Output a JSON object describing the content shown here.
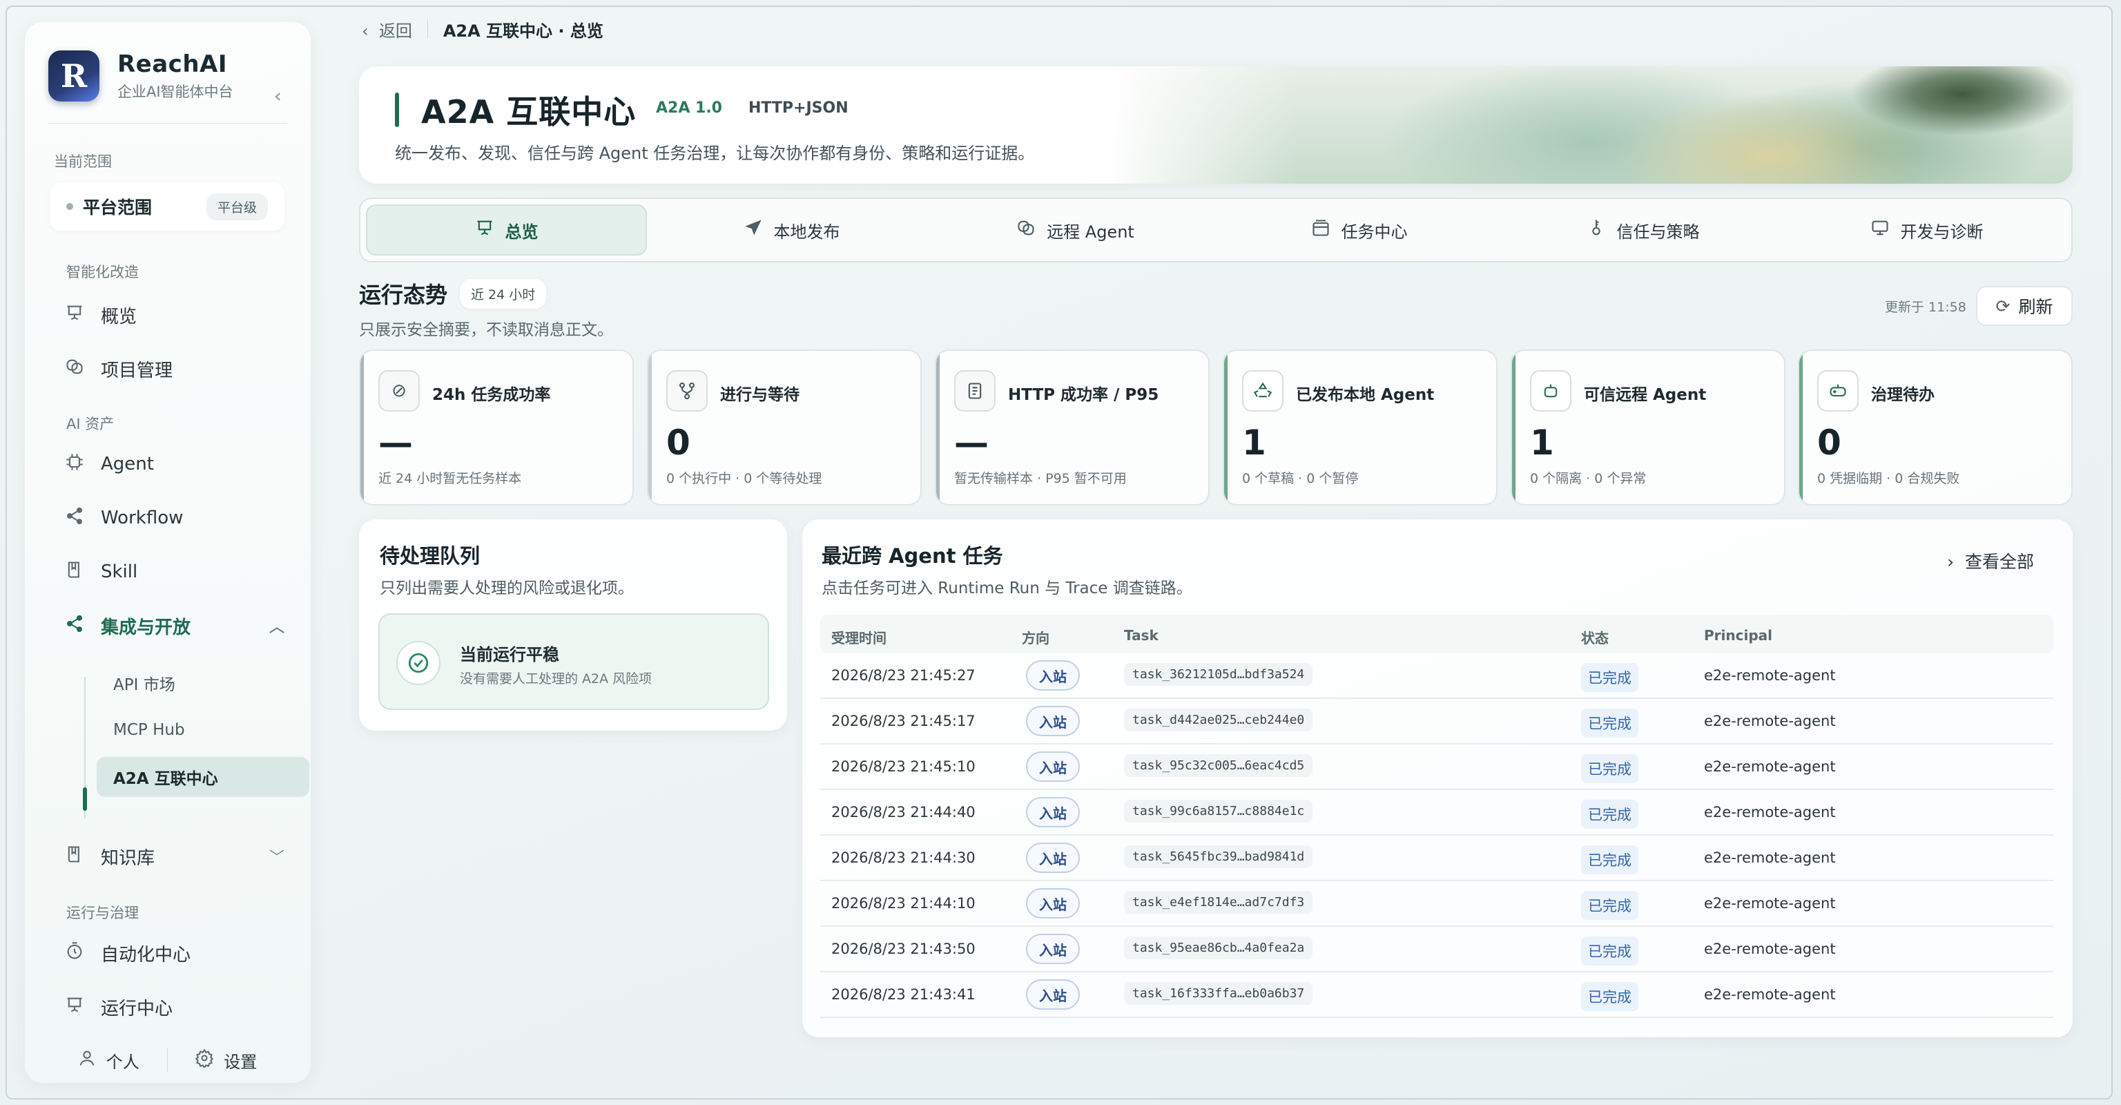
{
  "sidebar": {
    "brand": {
      "name": "ReachAI",
      "subtitle": "企业AI智能体中台",
      "logo_letter": "R"
    },
    "scope_label": "当前范围",
    "scope": {
      "name": "平台范围",
      "badge": "平台级"
    },
    "groups": {
      "g1": "智能化改造",
      "g2": "AI 资产",
      "g3": "运行与治理"
    },
    "items": {
      "overview": "概览",
      "projects": "项目管理",
      "agent": "Agent",
      "workflow": "Workflow",
      "skill": "Skill",
      "integration": "集成与开放",
      "knowledge": "知识库",
      "automation": "自动化中心",
      "runtime": "运行中心"
    },
    "sub_items": {
      "api_market": "API 市场",
      "mcp_hub": "MCP Hub",
      "a2a": "A2A 互联中心"
    },
    "bottom": {
      "personal": "个人",
      "settings": "设置"
    }
  },
  "breadcrumb": {
    "back": "返回",
    "title": "A2A 互联中心 · 总览"
  },
  "hero": {
    "title": "A2A 互联中心",
    "tag_version": "A2A 1.0",
    "tag_protocol": "HTTP+JSON",
    "subtitle": "统一发布、发现、信任与跨 Agent 任务治理，让每次协作都有身份、策略和运行证据。"
  },
  "tabs": {
    "overview": "总览",
    "local_publish": "本地发布",
    "remote_agent": "远程 Agent",
    "task_center": "任务中心",
    "trust_policy": "信任与策略",
    "dev_diag": "开发与诊断"
  },
  "status_section": {
    "title": "运行态势",
    "chip": "近 24 小时",
    "desc": "只展示安全摘要，不读取消息正文。",
    "updated": "更新于 11:58",
    "refresh": "刷新"
  },
  "kpis": [
    {
      "label": "24h 任务成功率",
      "value": "—",
      "sub": "近 24 小时暂无任务样本",
      "edge": "#a9b6ba"
    },
    {
      "label": "进行与等待",
      "value": "0",
      "sub": "0 个执行中 · 0 个等待处理",
      "edge": "#c5cfd1"
    },
    {
      "label": "HTTP 成功率 / P95",
      "value": "—",
      "sub": "暂无传输样本 · P95 暂不可用",
      "edge": "#a9b6ba"
    },
    {
      "label": "已发布本地 Agent",
      "value": "1",
      "sub": "0 个草稿 · 0 个暂停",
      "edge": "#6fa58c"
    },
    {
      "label": "可信远程 Agent",
      "value": "1",
      "sub": "0 个隔离 · 0 个异常",
      "edge": "#6fa58c"
    },
    {
      "label": "治理待办",
      "value": "0",
      "sub": "0 凭据临期 · 0 合规失败",
      "edge": "#6fa58c"
    }
  ],
  "queue": {
    "title": "待处理队列",
    "desc": "只列出需要人处理的风险或退化项。",
    "ok_title": "当前运行平稳",
    "ok_sub": "没有需要人工处理的 A2A 风险项"
  },
  "tasks": {
    "title": "最近跨 Agent 任务",
    "desc": "点击任务可进入 Runtime Run 与 Trace 调查链路。",
    "view_all": "查看全部",
    "columns": {
      "time": "受理时间",
      "direction": "方向",
      "task": "Task",
      "status": "状态",
      "principal": "Principal"
    },
    "rows": [
      {
        "time": "2026/8/23 21:45:27",
        "direction": "入站",
        "task": "task_36212105d…bdf3a524",
        "status": "已完成",
        "principal": "e2e-remote-agent"
      },
      {
        "time": "2026/8/23 21:45:17",
        "direction": "入站",
        "task": "task_d442ae025…ceb244e0",
        "status": "已完成",
        "principal": "e2e-remote-agent"
      },
      {
        "time": "2026/8/23 21:45:10",
        "direction": "入站",
        "task": "task_95c32c005…6eac4cd5",
        "status": "已完成",
        "principal": "e2e-remote-agent"
      },
      {
        "time": "2026/8/23 21:44:40",
        "direction": "入站",
        "task": "task_99c6a8157…c8884e1c",
        "status": "已完成",
        "principal": "e2e-remote-agent"
      },
      {
        "time": "2026/8/23 21:44:30",
        "direction": "入站",
        "task": "task_5645fbc39…bad9841d",
        "status": "已完成",
        "principal": "e2e-remote-agent"
      },
      {
        "time": "2026/8/23 21:44:10",
        "direction": "入站",
        "task": "task_e4ef1814e…ad7c7df3",
        "status": "已完成",
        "principal": "e2e-remote-agent"
      },
      {
        "time": "2026/8/23 21:43:50",
        "direction": "入站",
        "task": "task_95eae86cb…4a0fea2a",
        "status": "已完成",
        "principal": "e2e-remote-agent"
      },
      {
        "time": "2026/8/23 21:43:41",
        "direction": "入站",
        "task": "task_16f333ffa…eb0a6b37",
        "status": "已完成",
        "principal": "e2e-remote-agent"
      }
    ]
  },
  "colors": {
    "accent": "#1f6b52",
    "status_blue": "#3467a8",
    "inbound": "#2d4f8a"
  }
}
